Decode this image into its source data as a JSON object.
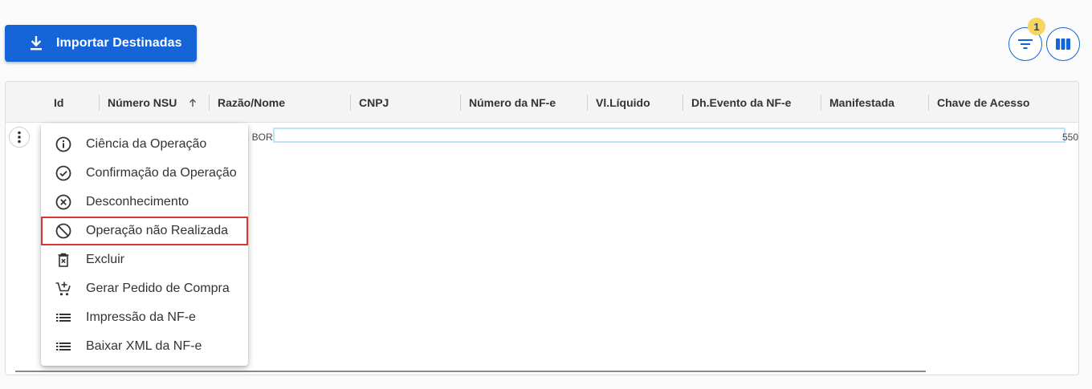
{
  "toolbar": {
    "import_label": "Importar Destinadas",
    "filter_badge": "1"
  },
  "grid": {
    "columns": [
      {
        "label": "Id"
      },
      {
        "label": "Número NSU"
      },
      {
        "label": "Razão/Nome"
      },
      {
        "label": "CNPJ"
      },
      {
        "label": "Número da NF-e"
      },
      {
        "label": "Vl.Líquido"
      },
      {
        "label": "Dh.Evento da NF-e"
      },
      {
        "label": "Manifestada"
      },
      {
        "label": "Chave de Acesso"
      }
    ],
    "row": {
      "razao_fragment": ". BOR",
      "chave_fragment": "550"
    }
  },
  "context_menu": {
    "items": [
      {
        "label": "Ciência da Operação",
        "icon": "info-icon"
      },
      {
        "label": "Confirmação da Operação",
        "icon": "check-circle-icon"
      },
      {
        "label": "Desconhecimento",
        "icon": "cancel-circle-icon"
      },
      {
        "label": "Operação não Realizada",
        "icon": "block-icon"
      },
      {
        "label": "Excluir",
        "icon": "trash-icon"
      },
      {
        "label": "Gerar Pedido de Compra",
        "icon": "cart-add-icon"
      },
      {
        "label": "Impressão da NF-e",
        "icon": "list-icon"
      },
      {
        "label": "Baixar XML da NF-e",
        "icon": "list-icon"
      }
    ]
  },
  "colors": {
    "primary": "#1565d8",
    "badge": "#f7d55f",
    "highlight_border": "#d93636",
    "selection_border": "#bfe3f2"
  }
}
